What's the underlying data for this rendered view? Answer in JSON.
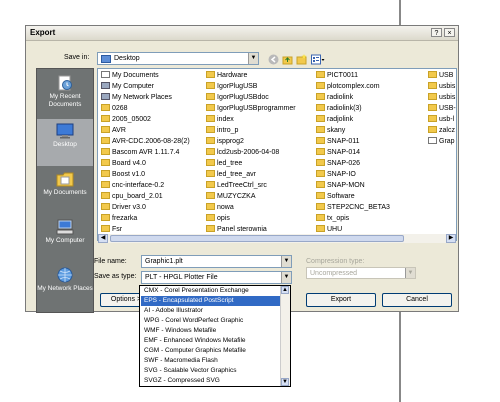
{
  "dialog": {
    "title": "Export",
    "help_btn": "?",
    "close_btn": "×"
  },
  "save_in": {
    "label": "Save in:",
    "value": "Desktop"
  },
  "places": [
    {
      "label": "My Recent Documents",
      "icon": "recent-documents-icon"
    },
    {
      "label": "Desktop",
      "icon": "desktop-icon"
    },
    {
      "label": "My Documents",
      "icon": "my-documents-icon"
    },
    {
      "label": "My Computer",
      "icon": "my-computer-icon"
    },
    {
      "label": "My Network Places",
      "icon": "network-places-icon"
    }
  ],
  "files": [
    [
      "My Documents",
      "My Computer",
      "My Network Places",
      "0268",
      "2005_05002",
      "AVR",
      "AVR-CDC.2006-08-28(2)",
      "Bascom AVR 1.11.7.4",
      "Board v4.0",
      "Boost v1.0",
      "cnc-interface-0.2",
      "cpu_board_2.01",
      "Driver v3.0",
      "frezarka",
      "Fsr"
    ],
    [
      "Hardware",
      "IgorPlugUSB",
      "IgorPlugUSBdoc",
      "IgorPlugUSBprogrammer",
      "index",
      "intro_p",
      "ispprog2",
      "lcd2usb-2006-04-08",
      "led_tree",
      "led_tree_avr",
      "LedTreeCtrl_src",
      "MUZYCZKA",
      "nowa",
      "opis",
      "Panel sterownia"
    ],
    [
      "PICT0011",
      "plotcomplex.com",
      "radiolink",
      "radiolink(3)",
      "radjolink",
      "skany",
      "SNAP-011",
      "SNAP-014",
      "SNAP-026",
      "SNAP-IO",
      "SNAP-MON",
      "Software",
      "STEP2CNC_BETA3",
      "tx_opis",
      "UHU"
    ],
    [
      "USB",
      "usbis",
      "usbis",
      "USB-",
      "usb-l",
      "zalcz",
      "Grap"
    ]
  ],
  "file_name": {
    "label": "File name:",
    "value": "Graphic1.plt"
  },
  "save_as_type": {
    "label": "Save as type:",
    "value": "PLT - HPGL Plotter File"
  },
  "compression": {
    "label": "Compression type:",
    "value": "Uncompressed"
  },
  "buttons": {
    "options": "Options >",
    "export": "Export",
    "cancel": "Cancel"
  },
  "type_options": [
    "CMX - Corel Presentation Exchange",
    "EPS - Encapsulated PostScript",
    "AI - Adobe Illustrator",
    "WPG - Corel WordPerfect Graphic",
    "WMF - Windows Metafile",
    "EMF - Enhanced Windows Metafile",
    "CGM - Computer Graphics Metafile",
    "SWF - Macromedia Flash",
    "SVG - Scalable Vector Graphics",
    "SVGZ - Compressed SVG"
  ],
  "highlighted_option": "EPS - Encapsulated PostScript"
}
